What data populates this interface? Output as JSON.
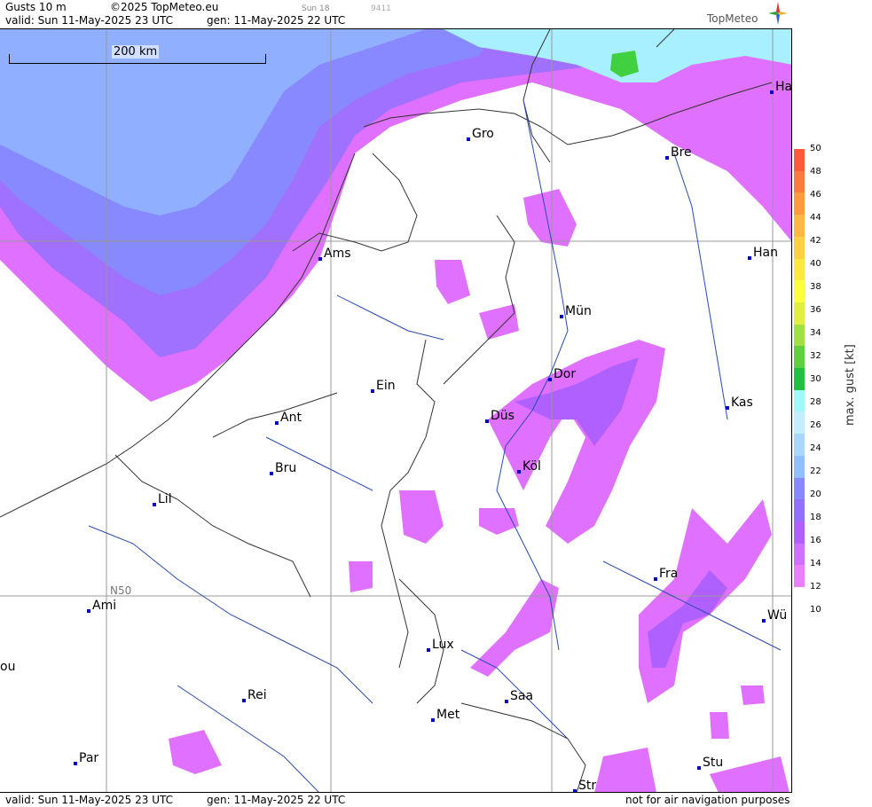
{
  "header": {
    "title": "Gusts 10 m",
    "copyright": "©2025 TopMeteo.eu",
    "day_small": "Sun 18",
    "code_small": "9411",
    "valid": "valid:  Sun  11-May-2025  23 UTC",
    "gen": "gen: 11-May-2025 22 UTC",
    "logo": "TopMeteo"
  },
  "footer": {
    "valid": "valid:  Sun  11-May-2025  23 UTC",
    "gen": "gen: 11-May-2025 22 UTC",
    "notice": "not for air navigation purposes"
  },
  "map": {
    "scale_label": "200 km",
    "grid_label": "N50",
    "cities": [
      {
        "name": "Gro"
      },
      {
        "name": "Bre"
      },
      {
        "name": "Ha"
      },
      {
        "name": "Ams"
      },
      {
        "name": "Han"
      },
      {
        "name": "Mün"
      },
      {
        "name": "Dor"
      },
      {
        "name": "Ein"
      },
      {
        "name": "Ant"
      },
      {
        "name": "Düs"
      },
      {
        "name": "Kas"
      },
      {
        "name": "Bru"
      },
      {
        "name": "Köl"
      },
      {
        "name": "Lil"
      },
      {
        "name": "Fra"
      },
      {
        "name": "Ami"
      },
      {
        "name": "Wü"
      },
      {
        "name": "Lux"
      },
      {
        "name": "ou"
      },
      {
        "name": "Rei"
      },
      {
        "name": "Saa"
      },
      {
        "name": "Met"
      },
      {
        "name": "Stu"
      },
      {
        "name": "Par"
      },
      {
        "name": "Str"
      }
    ]
  },
  "legend": {
    "title": "max. gust [kt]",
    "labels": [
      "50",
      "48",
      "46",
      "44",
      "42",
      "40",
      "38",
      "36",
      "34",
      "32",
      "30",
      "28",
      "26",
      "24",
      "22",
      "20",
      "18",
      "16",
      "14",
      "12",
      "10"
    ],
    "colors": [
      "#ff5a3c",
      "#ff7a40",
      "#ff9a40",
      "#ffb840",
      "#ffd040",
      "#ffe840",
      "#ffff40",
      "#e0f040",
      "#a0e040",
      "#60d040",
      "#20c040",
      "#a0f8f8",
      "#c0f0ff",
      "#a8d8ff",
      "#90c0ff",
      "#8888ff",
      "#9070ff",
      "#b060ff",
      "#d070ff",
      "#e880ff"
    ]
  }
}
